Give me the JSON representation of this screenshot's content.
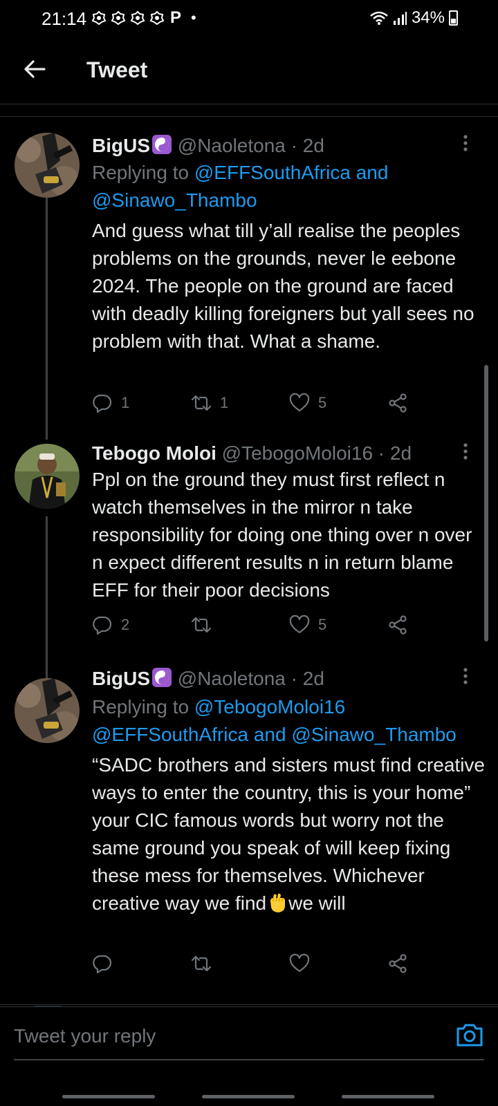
{
  "status_bar": {
    "time": "21:14",
    "notif_letter": "P",
    "dot": "•",
    "battery": "34%"
  },
  "header": {
    "title": "Tweet"
  },
  "tweets": [
    {
      "name": "BigUS",
      "handle": "@Naoletona · 2d",
      "replying_prefix": "Replying to ",
      "replying_mentions": "@EFFSouthAfrica and @Sinawo_Thambo",
      "body": "And guess what till y’all realise the peoples problems on the grounds, never le eebone 2024. The people on the ground are faced with deadly killing foreigners but yall sees no problem with that. What a shame.",
      "replies": "1",
      "retweets": "1",
      "likes": "5"
    },
    {
      "name": "Tebogo Moloi",
      "handle": "@TebogoMoloi16 · 2d",
      "body": "Ppl on the ground they must first reflect n watch themselves in the mirror n take responsibility for doing one thing over n over n expect different results n in return blame EFF for their poor decisions",
      "replies": "2",
      "retweets": "",
      "likes": "5"
    },
    {
      "name": "BigUS",
      "handle": "@Naoletona · 2d",
      "replying_prefix": "Replying to ",
      "replying_mentions": "@TebogoMoloi16 @EFFSouthAfrica and @Sinawo_Thambo",
      "body_before_emoji": "“SADC brothers and sisters must find creative ways to enter the country, this is your home” your CIC famous words but worry not the same ground you speak of will keep fixing these mess for themselves. Whichever creative way we find",
      "body_after_emoji": "we will",
      "replies": "",
      "retweets": "",
      "likes": ""
    }
  ],
  "composer": {
    "placeholder": "Tweet your reply"
  },
  "colors": {
    "accent": "#1d9bf0",
    "muted": "#71767b",
    "text": "#e7e9ea",
    "background": "#000000"
  }
}
